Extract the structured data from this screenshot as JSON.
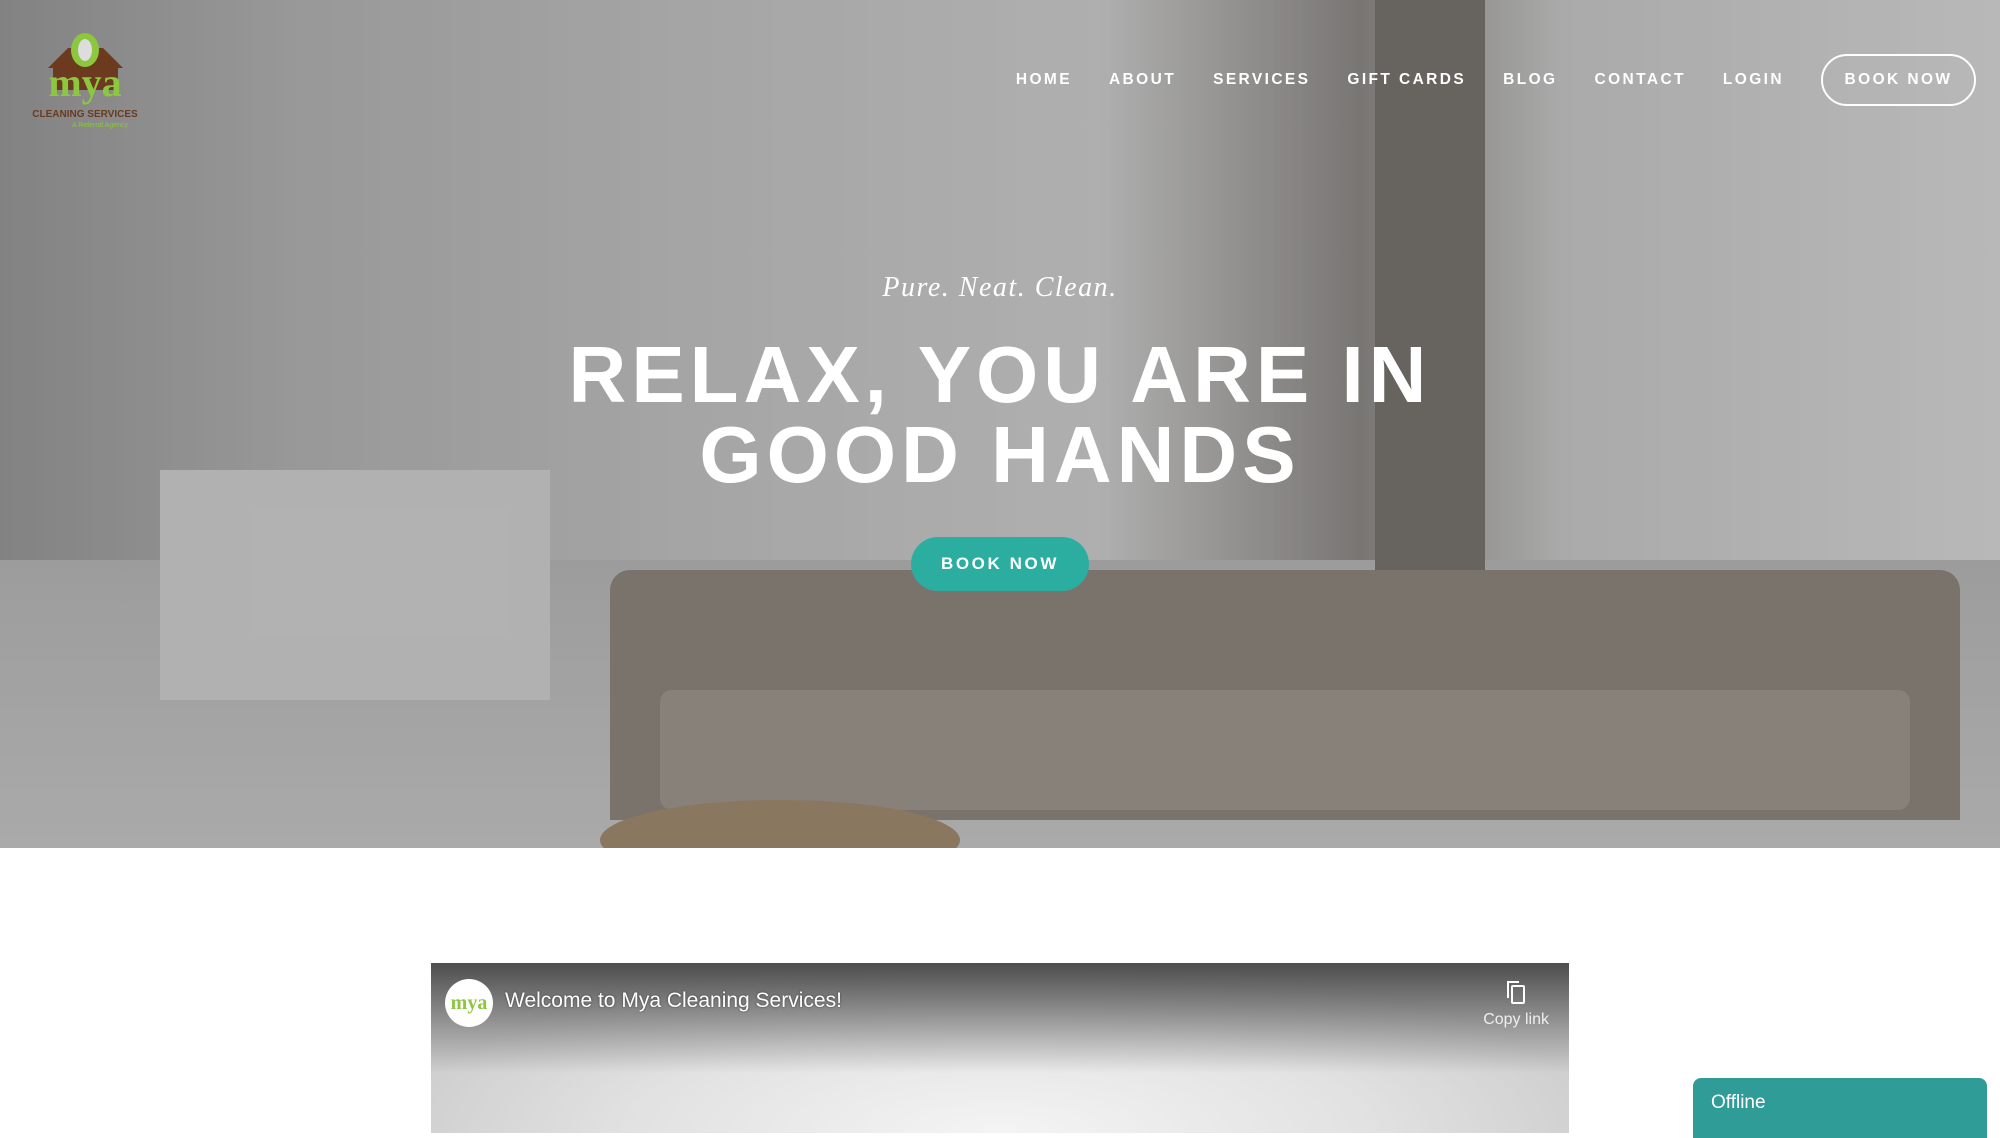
{
  "brand": {
    "logo_text": "mya",
    "logo_subtitle": "CLEANING SERVICES",
    "logo_tagline": "A Referral Agency",
    "colors": {
      "green": "#8dc63f",
      "brown": "#6b3a1f",
      "teal": "#2bada0"
    }
  },
  "nav": {
    "items": [
      {
        "label": "HOME"
      },
      {
        "label": "ABOUT"
      },
      {
        "label": "SERVICES"
      },
      {
        "label": "GIFT CARDS"
      },
      {
        "label": "BLOG"
      },
      {
        "label": "CONTACT"
      },
      {
        "label": "LOGIN"
      }
    ],
    "book_label": "BOOK NOW"
  },
  "hero": {
    "tagline": "Pure. Neat. Clean.",
    "headline_line1": "RELAX, YOU ARE IN",
    "headline_line2": "GOOD HANDS",
    "button": "BOOK NOW"
  },
  "video": {
    "title": "Welcome to Mya Cleaning Services!",
    "copy_link": "Copy link",
    "icon": "copy-icon"
  },
  "chat": {
    "status": "Offline"
  }
}
